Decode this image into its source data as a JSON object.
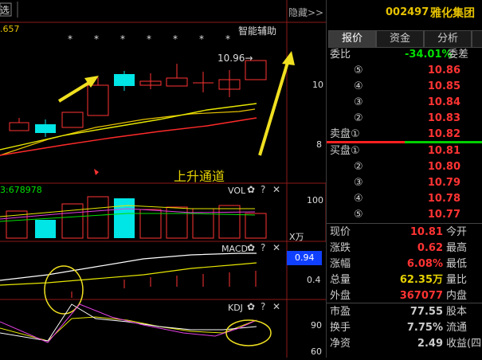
{
  "toolbar": {
    "left_label": "选",
    "hide_label": "隐藏>>",
    "assist_label": "智能辅助"
  },
  "main_chart": {
    "left_value": ".657",
    "price_marker": "10.96→",
    "annotation": "上升通道",
    "star": "*",
    "y_labels": [
      "10",
      "8"
    ]
  },
  "vol_panel": {
    "label": "3:678978",
    "title": "VOL",
    "y_labels": [
      "100",
      "X万"
    ]
  },
  "macd_panel": {
    "title": "MACD",
    "y_labels": [
      "0.94",
      "0.4"
    ]
  },
  "kdj_panel": {
    "title": "KDJ",
    "y_labels": [
      "90",
      "60"
    ]
  },
  "tool_icons": {
    "gear": "✿",
    "help": "?",
    "close": "✕"
  },
  "stock": {
    "code": "002497",
    "name": "雅化集团"
  },
  "tabs": [
    "报价",
    "资金",
    "分析"
  ],
  "webi": {
    "label": "委比",
    "value": "-34.01%",
    "label2": "委差"
  },
  "sell": [
    {
      "idx": "⑤",
      "price": "10.86"
    },
    {
      "idx": "④",
      "price": "10.85"
    },
    {
      "idx": "③",
      "price": "10.84"
    },
    {
      "idx": "②",
      "price": "10.83"
    },
    {
      "idx": "卖盘①",
      "price": "10.82"
    }
  ],
  "buy": [
    {
      "idx": "买盘①",
      "price": "10.81"
    },
    {
      "idx": "②",
      "price": "10.80"
    },
    {
      "idx": "③",
      "price": "10.79"
    },
    {
      "idx": "④",
      "price": "10.78"
    },
    {
      "idx": "⑤",
      "price": "10.77"
    }
  ],
  "stats": [
    {
      "l": "现价",
      "v": "10.81",
      "r": "今开",
      "color": "#ff3333"
    },
    {
      "l": "涨跌",
      "v": "0.62",
      "r": "最高",
      "color": "#ff3333"
    },
    {
      "l": "涨幅",
      "v": "6.08%",
      "r": "最低",
      "color": "#ff3333"
    },
    {
      "l": "总量",
      "v": "62.35万",
      "r": "量比",
      "color": "#e6d200"
    },
    {
      "l": "外盘",
      "v": "367077",
      "r": "内盘",
      "color": "#ff3333"
    }
  ],
  "stats2": [
    {
      "l": "市盈",
      "v": "77.55",
      "r": "股本",
      "color": "#cccccc"
    },
    {
      "l": "换手",
      "v": "7.75%",
      "r": "流通",
      "color": "#cccccc"
    },
    {
      "l": "净资",
      "v": "2.49",
      "r": "收益(四",
      "color": "#cccccc"
    }
  ]
}
